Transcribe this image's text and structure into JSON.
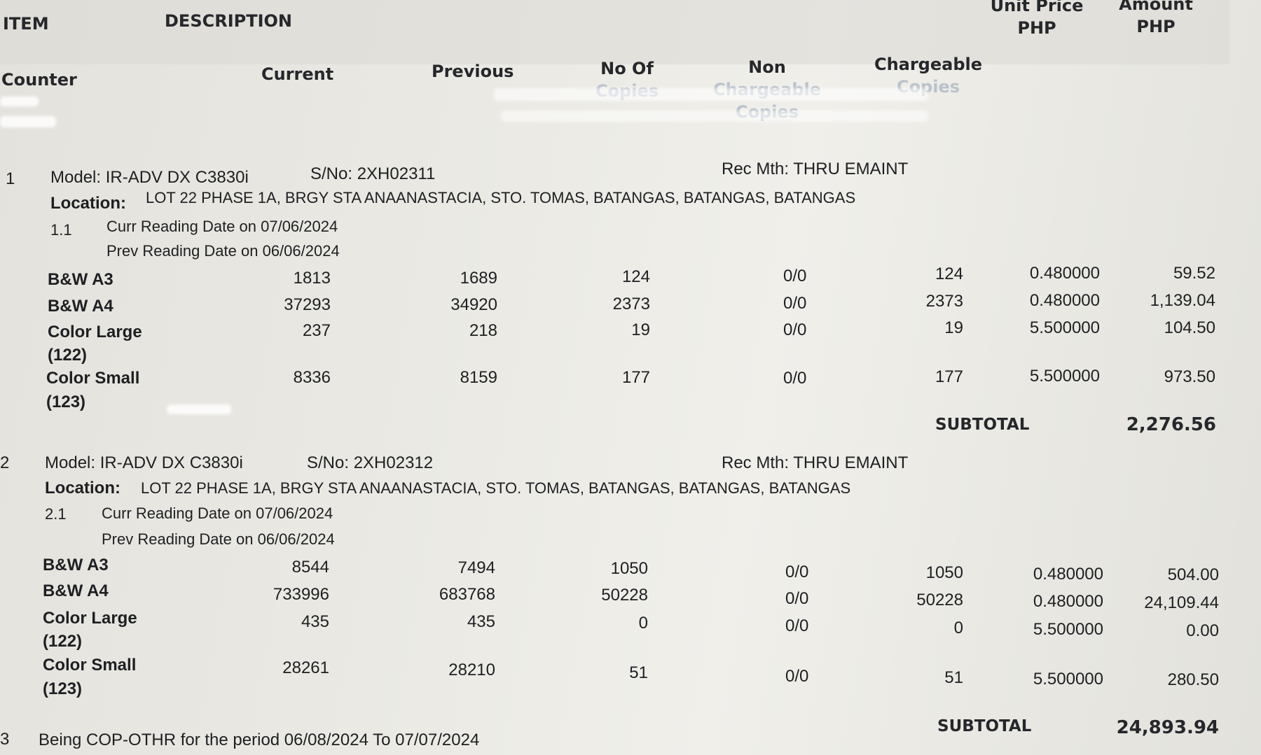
{
  "header": {
    "item": "ITEM",
    "description": "DESCRIPTION",
    "unit_price": [
      "Unit Price",
      "PHP"
    ],
    "amount": [
      "Amount",
      "PHP"
    ],
    "counter": "Counter",
    "current": "Current",
    "previous": "Previous",
    "no_of_copies": [
      "No Of",
      "Copies"
    ],
    "non_chargeable": [
      "Non",
      "Chargeable",
      "Copies"
    ],
    "chargeable": [
      "Chargeable",
      "Copies"
    ]
  },
  "items": [
    {
      "no": "1",
      "model": "Model: IR-ADV DX C3830i",
      "serial": "S/No: 2XH02311",
      "rec_mth": "Rec Mth: THRU EMAINT",
      "location_label": "Location:",
      "location": "LOT 22 PHASE 1A, BRGY STA ANAANASTACIA, STO. TOMAS, BATANGAS, BATANGAS, BATANGAS",
      "sub_no": "1.1",
      "curr_date": "Curr Reading Date on 07/06/2024",
      "prev_date": "Prev Reading Date on 06/06/2024",
      "rows": [
        {
          "counter": "B&W A3",
          "counter2": "",
          "current": "1813",
          "previous": "1689",
          "copies": "124",
          "non": "0/0",
          "charge": "124",
          "price": "0.480000",
          "amount": "59.52"
        },
        {
          "counter": "B&W A4",
          "counter2": "",
          "current": "37293",
          "previous": "34920",
          "copies": "2373",
          "non": "0/0",
          "charge": "2373",
          "price": "0.480000",
          "amount": "1,139.04"
        },
        {
          "counter": "Color Large",
          "counter2": "(122)",
          "current": "237",
          "previous": "218",
          "copies": "19",
          "non": "0/0",
          "charge": "19",
          "price": "5.500000",
          "amount": "104.50"
        },
        {
          "counter": "Color Small",
          "counter2": "(123)",
          "current": "8336",
          "previous": "8159",
          "copies": "177",
          "non": "0/0",
          "charge": "177",
          "price": "5.500000",
          "amount": "973.50"
        }
      ],
      "subtotal_label": "SUBTOTAL",
      "subtotal": "2,276.56"
    },
    {
      "no": "2",
      "model": "Model: IR-ADV DX C3830i",
      "serial": "S/No: 2XH02312",
      "rec_mth": "Rec Mth: THRU EMAINT",
      "location_label": "Location:",
      "location": "LOT 22 PHASE 1A, BRGY STA ANAANASTACIA, STO. TOMAS, BATANGAS, BATANGAS, BATANGAS",
      "sub_no": "2.1",
      "curr_date": "Curr Reading Date on 07/06/2024",
      "prev_date": "Prev Reading Date on 06/06/2024",
      "rows": [
        {
          "counter": "B&W A3",
          "counter2": "",
          "current": "8544",
          "previous": "7494",
          "copies": "1050",
          "non": "0/0",
          "charge": "1050",
          "price": "0.480000",
          "amount": "504.00"
        },
        {
          "counter": "B&W A4",
          "counter2": "",
          "current": "733996",
          "previous": "683768",
          "copies": "50228",
          "non": "0/0",
          "charge": "50228",
          "price": "0.480000",
          "amount": "24,109.44"
        },
        {
          "counter": "Color Large",
          "counter2": "(122)",
          "current": "435",
          "previous": "435",
          "copies": "0",
          "non": "0/0",
          "charge": "0",
          "price": "5.500000",
          "amount": "0.00"
        },
        {
          "counter": "Color Small",
          "counter2": "(123)",
          "current": "28261",
          "previous": "28210",
          "copies": "51",
          "non": "0/0",
          "charge": "51",
          "price": "5.500000",
          "amount": "280.50"
        }
      ],
      "subtotal_label": "SUBTOTAL",
      "subtotal": "24,893.94"
    }
  ],
  "footer": {
    "no": "3",
    "text": "Being COP-OTHR for the period 06/08/2024 To 07/07/2024"
  }
}
